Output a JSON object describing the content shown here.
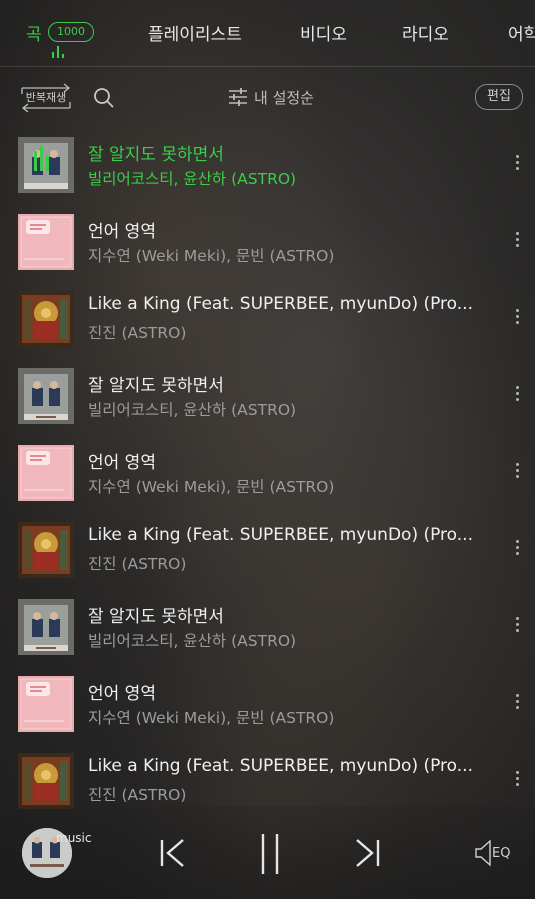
{
  "tabs": {
    "songs": {
      "label": "곡",
      "count": "1000"
    },
    "playlist": "플레이리스트",
    "video": "비디오",
    "radio": "라디오",
    "partial": "어학"
  },
  "toolbar": {
    "repeat_label": "반복재생",
    "sort_label": "내 설정순",
    "edit_label": "편집"
  },
  "tracks": [
    {
      "title": "잘 알지도 못하면서",
      "artist": "빌리어코스티, 윤산하 (ASTRO)",
      "playing": true
    },
    {
      "title": "언어 영역",
      "artist": "지수연 (Weki Meki), 문빈 (ASTRO)"
    },
    {
      "title": "Like a King (Feat. SUPERBEE, myunDo) (Pro...",
      "artist": "진진 (ASTRO)"
    },
    {
      "title": "잘 알지도 못하면서",
      "artist": "빌리어코스티, 윤산하 (ASTRO)"
    },
    {
      "title": "언어 영역",
      "artist": "지수연 (Weki Meki), 문빈 (ASTRO)"
    },
    {
      "title": "Like a King (Feat. SUPERBEE, myunDo) (Pro...",
      "artist": "진진 (ASTRO)"
    },
    {
      "title": "잘 알지도 못하면서",
      "artist": "빌리어코스티, 윤산하 (ASTRO)"
    },
    {
      "title": "언어 영역",
      "artist": "지수연 (Weki Meki), 문빈 (ASTRO)"
    },
    {
      "title": "Like a King (Feat. SUPERBEE, myunDo) (Pro...",
      "artist": "진진 (ASTRO)"
    }
  ],
  "player": {
    "source_label": "music",
    "eq_label": "EQ"
  },
  "colors": {
    "accent": "#3ccc4a",
    "background": "#2a2928"
  },
  "icons": {
    "search": "search-icon",
    "sort": "sliders-icon",
    "more": "more-vertical-icon",
    "previous": "skip-previous-icon",
    "pause": "pause-icon",
    "next": "skip-next-icon",
    "eq": "speaker-eq-icon"
  }
}
